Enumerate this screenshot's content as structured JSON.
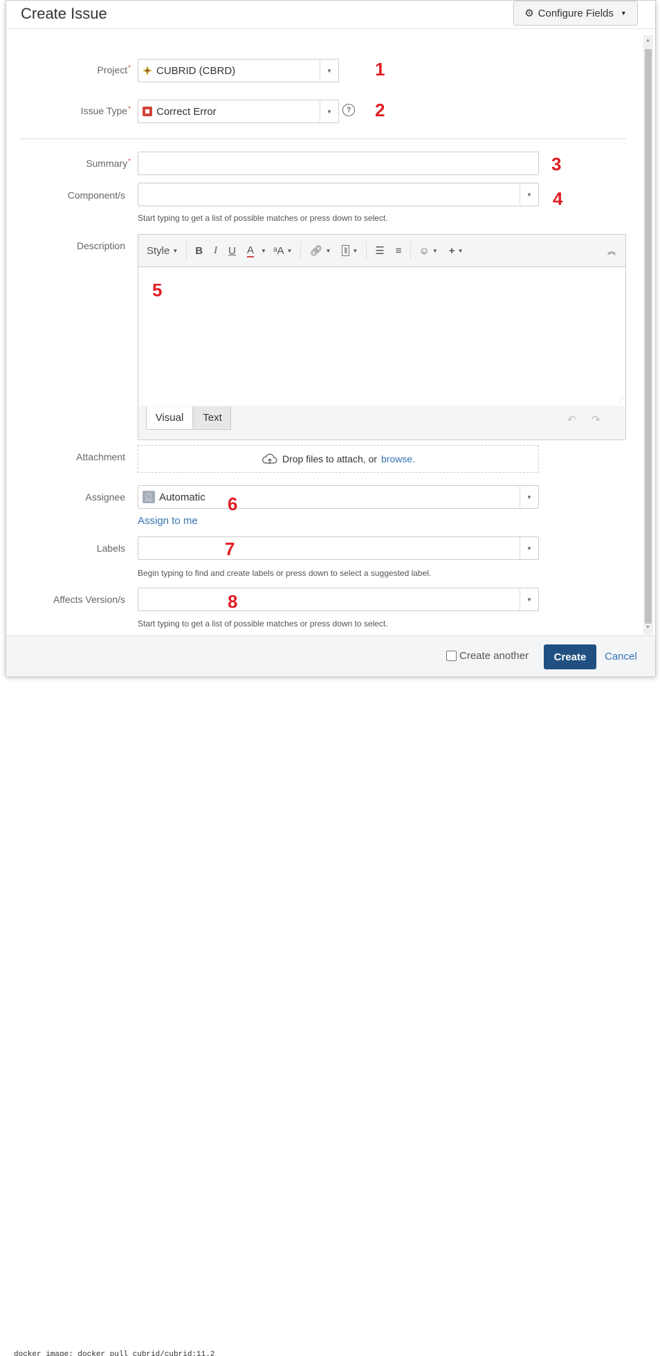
{
  "background": {
    "text": "docker image: docker pull cubrid/cubrid:11.2"
  },
  "dialog": {
    "title": "Create Issue",
    "configure_fields": "Configure Fields"
  },
  "fields": {
    "project": {
      "label": "Project",
      "value": "CUBRID (CBRD)",
      "marker": "1"
    },
    "issue_type": {
      "label": "Issue Type",
      "value": "Correct Error",
      "marker": "2"
    },
    "summary": {
      "label": "Summary",
      "value": "",
      "marker": "3"
    },
    "components": {
      "label": "Component/s",
      "value": "",
      "hint": "Start typing to get a list of possible matches or press down to select.",
      "marker": "4"
    },
    "description": {
      "label": "Description",
      "marker": "5",
      "toolbar": {
        "style": "Style",
        "bold": "B",
        "italic": "I",
        "underline": "U",
        "text_color": "A",
        "text_size": "ᵃA"
      },
      "tabs": {
        "visual": "Visual",
        "text": "Text"
      }
    },
    "attachment": {
      "label": "Attachment",
      "drop_text": "Drop files to attach, or",
      "browse": "browse."
    },
    "assignee": {
      "label": "Assignee",
      "value": "Automatic",
      "assign_to_me": "Assign to me",
      "marker": "6"
    },
    "labels": {
      "label": "Labels",
      "value": "",
      "hint": "Begin typing to find and create labels or press down to select a suggested label.",
      "marker": "7"
    },
    "affects_versions": {
      "label": "Affects Version/s",
      "value": "",
      "hint": "Start typing to get a list of possible matches or press down to select.",
      "marker": "8"
    }
  },
  "footer": {
    "create_another": "Create another",
    "create": "Create",
    "cancel": "Cancel"
  },
  "colors": {
    "primary": "#205081",
    "link": "#3572b0",
    "required": "#d04437",
    "marker": "#e01e25"
  }
}
